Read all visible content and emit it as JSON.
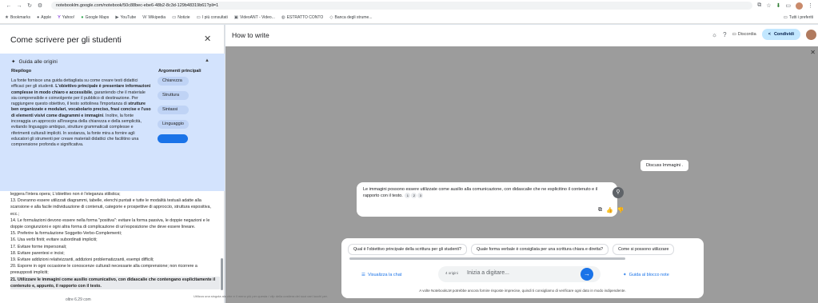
{
  "browser": {
    "url": "notebooklm.google.com/notebook/50c88bec-ebe6-48b2-8c3d-129b48319b61?pli=1",
    "bookmarks": [
      "Bookmarks",
      "Apple",
      "Yahoo!",
      "Google Maps",
      "YouTube",
      "Wikipedia",
      "Notizie",
      "I più consultati",
      "VideoANT - Video...",
      "ESTRATTO CONTO",
      "Banca degli strume..."
    ],
    "bookmarks_right": "Tutti i preferiti"
  },
  "left_panel": {
    "title": "Come scrivere per gli studenti",
    "guide_title": "Guida alle origini",
    "riepilogo_label": "Riepilogo",
    "arguments_label": "Argomenti principali",
    "summary_parts": [
      "La fonte fornisce una guida dettagliata su come creare testi didattici efficaci per gli studenti. ",
      "L'obiettivo principale è presentare informazioni complesse in modo chiaro e accessibile",
      ", garantendo che il materiale sia comprensibile e coinvolgente per il pubblico di destinazione. Per raggiungere questo obiettivo, il testo sottolinea l'importanza di ",
      "strutture ben organizzate e modulari, vocabolario preciso, frasi concise e l'uso di elementi visivi come diagrammi e immagini",
      ". Inoltre, la fonte incoraggia un approccio all'insegna della chiarezza e della semplicità, evitando linguaggio ambiguo, strutture grammaticali complesse e riferimenti culturali impliciti. In sostanza, la fonte mira a fornire agli educatori gli strumenti per creare materiali didattici che facilitino una comprensione profonda e significativa."
    ],
    "topics": [
      "Chiarezza",
      "Struttura",
      "Sintassi",
      "Linguaggio",
      ""
    ],
    "notes": [
      "leggera l'intera opera; L'obiettivo non è l'eleganza stilistica;",
      "13. Dovranno essere utilizzati diagrammi, tabelle, elenchi puntati e tutte le modalità testuali adatte alla scansione e alla facile individuazione di contenuti, categorie e prospettive di approccio, struttura espositiva, ecc.;",
      "14. Le formulazioni devono essere nella forma \"positiva\": evitare la forma passiva, le doppie negazioni e le doppie congiunzioni e ogni altra forma di complicazione di un'esposizione che deve essere lineare.",
      "15. Preferire la formulazione Soggetto-Verbo-Complementi;",
      "16. Usa verbi finiti; evitare subordinati impliciti;",
      "17. Evitare forme impersonali;",
      "18. Evitare parentesi e incisi;",
      "19. Evitare addizioni relativizzanti, addizioni problematizzanti, esempi difficili;",
      "20. Esporre in ogni occasione le conoscenze culturali necessarie alla comprensione; non ricorrere a presupposti impliciti;",
      "21. Utilizzare le immagini come ausilio comunicativo, con didascalie che contengano esplicitamente il contenuto e, appunto, il rapporto con il testo."
    ],
    "cut_text": "oltre 6.29 com"
  },
  "main": {
    "title": "How to write",
    "discord_label": "Discordia",
    "share_label": "Condividi",
    "user_message": "Discuss Immagini .",
    "bot_message": "Le immagini possono essere utilizzate come ausilio alla comunicazione, con didascalie che ne esplicitino il contenuto e il rapporto con il testo.",
    "citations": [
      "1",
      "2",
      "3"
    ],
    "suggestions": [
      "Qual è l'obiettivo principale della scrittura per gli studenti?",
      "Quale forma verbale è consigliata per una scrittura chiara e diretta?",
      "Come si possono utilizzare"
    ],
    "view_chat_label": "Visualizza la chat",
    "sources_count": "4 origini",
    "input_placeholder": "Inizia a digitare...",
    "notes_guide_label": "Guida al blocco note",
    "disclaimer": "A volte NotebookLM potrebbe ancora fornire risposte imprecise, quindi ti consigliamo di verificare ogni dato in modo indipendente.",
    "background_text": "Utilizza una singola ala che e il meno più per questa / clip della costiera dei suoi cari lucchi per."
  }
}
